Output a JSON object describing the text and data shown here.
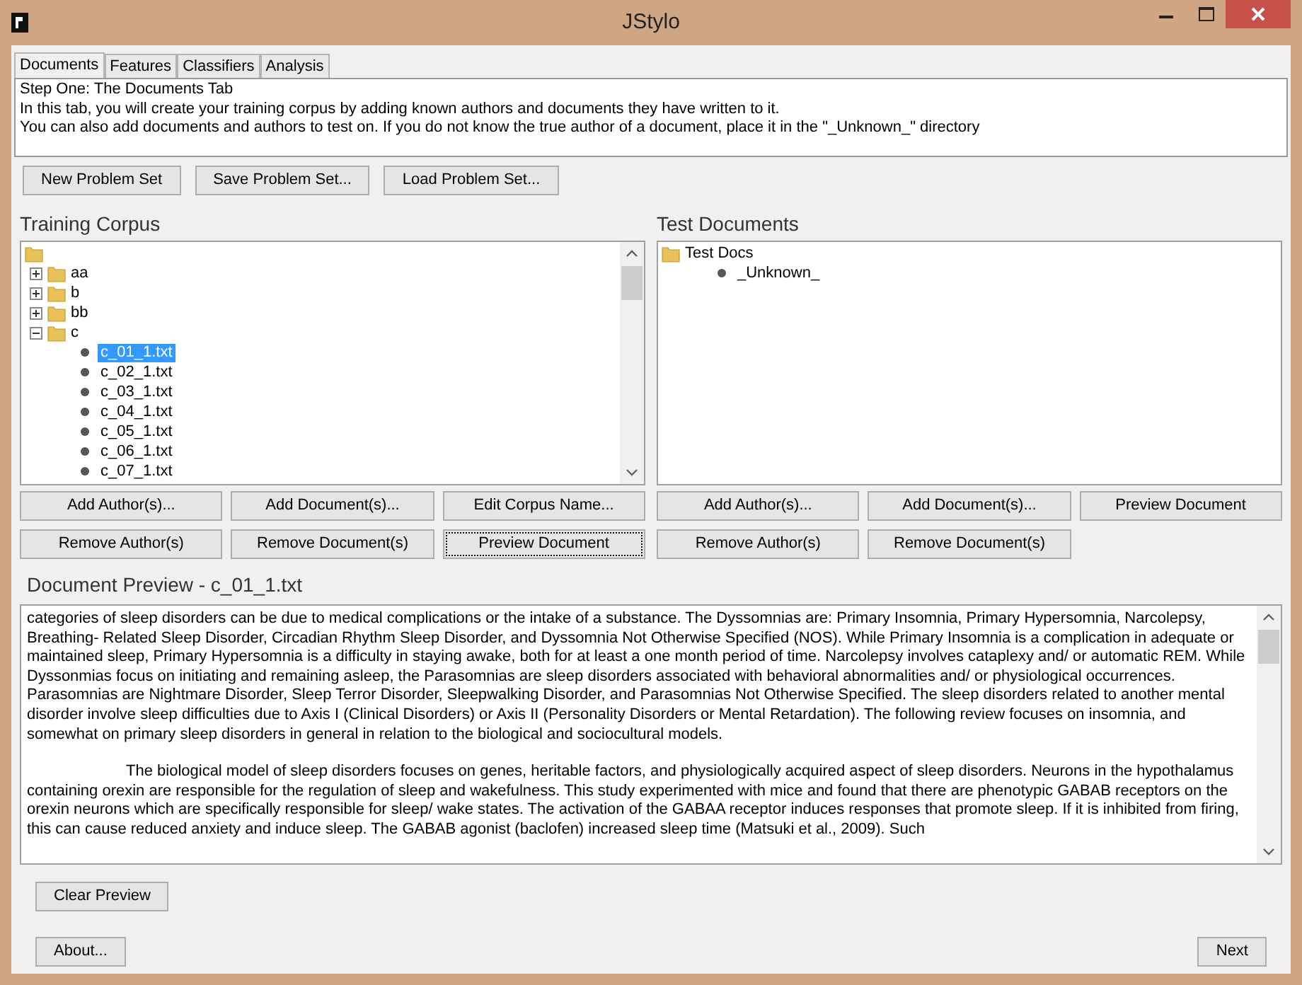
{
  "window": {
    "title": "JStylo"
  },
  "tabs": [
    {
      "label": "Documents",
      "selected": true
    },
    {
      "label": "Features",
      "selected": false
    },
    {
      "label": "Classifiers",
      "selected": false
    },
    {
      "label": "Analysis",
      "selected": false
    }
  ],
  "instructions": [
    "Step One: The Documents Tab",
    "In this tab, you will create your training corpus by adding known authors and documents they have written to it.",
    "You can also add documents and authors to test on. If you do not know the true author of a document, place it in the \"_Unknown_\" directory"
  ],
  "problem_set_buttons": [
    "New Problem Set",
    "Save Problem Set...",
    "Load Problem Set..."
  ],
  "training_corpus": {
    "title": "Training Corpus",
    "tree": [
      {
        "label": "aa",
        "expanded": false
      },
      {
        "label": "b",
        "expanded": false
      },
      {
        "label": "bb",
        "expanded": false
      },
      {
        "label": "c",
        "expanded": true,
        "children": [
          {
            "label": "c_01_1.txt",
            "selected": true
          },
          {
            "label": "c_02_1.txt",
            "selected": false
          },
          {
            "label": "c_03_1.txt",
            "selected": false
          },
          {
            "label": "c_04_1.txt",
            "selected": false
          },
          {
            "label": "c_05_1.txt",
            "selected": false
          },
          {
            "label": "c_06_1.txt",
            "selected": false
          },
          {
            "label": "c_07_1.txt",
            "selected": false
          }
        ]
      }
    ],
    "buttons": [
      {
        "label": "Add Author(s)...",
        "focused": false
      },
      {
        "label": "Add Document(s)...",
        "focused": false
      },
      {
        "label": "Edit Corpus Name...",
        "focused": false
      },
      {
        "label": "Remove Author(s)",
        "focused": false
      },
      {
        "label": "Remove Document(s)",
        "focused": false
      },
      {
        "label": "Preview Document",
        "focused": true
      }
    ]
  },
  "test_documents": {
    "title": "Test Documents",
    "tree": [
      {
        "label": "Test Docs",
        "children": [
          {
            "label": "_Unknown_",
            "selected": false
          }
        ]
      }
    ],
    "buttons": [
      "Add Author(s)...",
      "Add Document(s)...",
      "Preview Document",
      "Remove Author(s)",
      "Remove Document(s)"
    ]
  },
  "preview": {
    "title": "Document Preview - c_01_1.txt",
    "paragraphs": [
      {
        "text": "categories of sleep disorders can be due to medical complications or the intake of a substance. The Dyssomnias are: Primary Insomnia, Primary Hypersomnia, Narcolepsy, Breathing- Related Sleep Disorder, Circadian Rhythm Sleep Disorder, and Dyssomnia Not Otherwise Specified (NOS). While Primary Insomnia is a complication in adequate or maintained sleep, Primary Hypersomnia is a difficulty in staying awake, both for at least a one month period of time. Narcolepsy involves cataplexy and/ or automatic REM. While Dyssonmias focus on initiating and remaining asleep, the Parasomnias are sleep disorders associated with behavioral abnormalities and/ or physiological occurrences. Parasomnias are Nightmare Disorder, Sleep Terror Disorder, Sleepwalking Disorder, and Parasomnias Not Otherwise Specified. The sleep disorders related to another mental disorder involve sleep difficulties due to Axis I (Clinical Disorders) or Axis II (Personality Disorders or Mental Retardation). The following review focuses on insomnia, and somewhat on primary sleep disorders in general in relation to the biological and sociocultural models.",
        "indented": false
      },
      {
        "text": "The biological model of sleep disorders focuses on genes, heritable factors, and physiologically acquired aspect of sleep disorders. Neurons in the hypothalamus containing orexin are responsible for the regulation of sleep and wakefulness. This study experimented with mice and found that there are phenotypic GABAB receptors on the orexin neurons which are specifically responsible for sleep/ wake states. The activation of the GABAA receptor induces responses that promote sleep. If it is inhibited from firing, this can cause reduced anxiety and induce sleep. The GABAB agonist (baclofen) increased sleep time (Matsuki et al., 2009). Such",
        "indented": true
      }
    ],
    "clear_button": "Clear Preview"
  },
  "footer": {
    "about_button": "About...",
    "next_button": "Next"
  }
}
